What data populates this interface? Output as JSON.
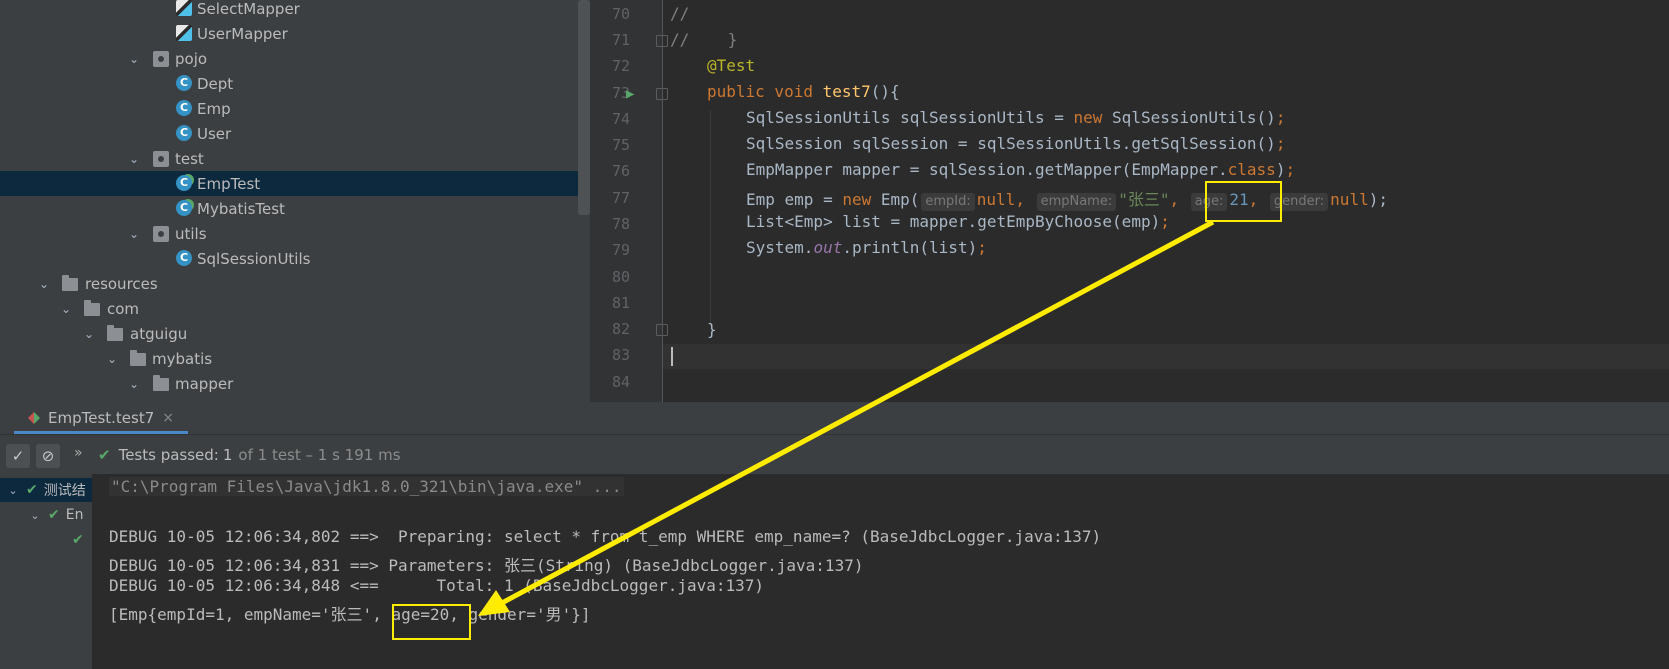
{
  "project_tree": {
    "items": [
      {
        "label": "SelectMapper",
        "icon": "mapper-xml-icon",
        "indent": 5
      },
      {
        "label": "UserMapper",
        "icon": "mapper-xml-icon",
        "indent": 5
      },
      {
        "label": "pojo",
        "icon": "package-icon",
        "indent": 4,
        "expanded": true
      },
      {
        "label": "Dept",
        "icon": "class-icon",
        "indent": 5
      },
      {
        "label": "Emp",
        "icon": "class-icon",
        "indent": 5
      },
      {
        "label": "User",
        "icon": "class-icon",
        "indent": 5
      },
      {
        "label": "test",
        "icon": "package-icon",
        "indent": 4,
        "expanded": true
      },
      {
        "label": "EmpTest",
        "icon": "test-class-icon",
        "indent": 5,
        "selected": true
      },
      {
        "label": "MybatisTest",
        "icon": "test-class-icon",
        "indent": 5
      },
      {
        "label": "utils",
        "icon": "package-icon",
        "indent": 4,
        "expanded": true
      },
      {
        "label": "SqlSessionUtils",
        "icon": "class-icon",
        "indent": 5
      },
      {
        "label": "resources",
        "icon": "resources-folder-icon",
        "indent": 1,
        "expanded": true
      },
      {
        "label": "com",
        "icon": "folder-icon",
        "indent": 2,
        "expanded": true
      },
      {
        "label": "atguigu",
        "icon": "folder-icon",
        "indent": 3,
        "expanded": true
      },
      {
        "label": "mybatis",
        "icon": "folder-icon",
        "indent": 4,
        "expanded": true
      },
      {
        "label": "mapper",
        "icon": "folder-icon",
        "indent": 5,
        "expanded": true
      }
    ]
  },
  "editor": {
    "line_numbers": [
      "70",
      "71",
      "72",
      "73",
      "74",
      "75",
      "76",
      "77",
      "78",
      "79",
      "80",
      "81",
      "82",
      "83",
      "84"
    ],
    "lines": {
      "l70": "//",
      "l71": "//    }",
      "l72_ann": "@Test",
      "l73_kw": "public void ",
      "l73_fn": "test7",
      "l73_rest": "(){",
      "l74_a": "SqlSessionUtils sqlSessionUtils = ",
      "l74_new": "new ",
      "l74_b": "SqlSessionUtils()",
      "l74_semi": ";",
      "l75_a": "SqlSession sqlSession = sqlSessionUtils.getSqlSession()",
      "l75_semi": ";",
      "l76_a": "EmpMapper mapper = sqlSession.getMapper(EmpMapper.",
      "l76_class": "class",
      "l76_b": ")",
      "l76_semi": ";",
      "l77_a": "Emp emp = ",
      "l77_new": "new ",
      "l77_b": "Emp(",
      "l77_hint1": "empId:",
      "l77_null1": "null",
      "l77_comma1": ", ",
      "l77_hint2": "empName:",
      "l77_str": "\"张三\"",
      "l77_comma2": ", ",
      "l77_hint3": "age:",
      "l77_num": "21",
      "l77_hint4": "gender:",
      "l77_null2": "null",
      "l77_end": ");",
      "l78_a": "List<Emp> list = mapper.getEmpByChoose(emp)",
      "l78_semi": ";",
      "l79_a": "System.",
      "l79_out": "out",
      "l79_b": ".println(list)",
      "l79_semi": ";",
      "l82": "}"
    }
  },
  "run_panel": {
    "tab_label": "EmpTest.test7",
    "tab_close": "×",
    "status_label": "Tests passed: ",
    "status_count": "1",
    "status_detail": "of 1 test – 1 s 191 ms",
    "more": "»",
    "tree": {
      "root_label": "测试结",
      "child_label": "En"
    },
    "console": [
      "\"C:\\Program Files\\Java\\jdk1.8.0_321\\bin\\java.exe\" ...",
      "",
      "DEBUG 10-05 12:06:34,802 ==>  Preparing: select * from t_emp WHERE emp_name=? (BaseJdbcLogger.java:137)",
      "DEBUG 10-05 12:06:34,831 ==> Parameters: 张三(String) (BaseJdbcLogger.java:137)",
      "DEBUG 10-05 12:06:34,848 <==      Total: 1 (BaseJdbcLogger.java:137)",
      "[Emp{empId=1, empName='张三', age=20, gender='男'}]"
    ]
  },
  "annotation": {
    "highlight_color": "#ffec00",
    "arrow_from": "age: 21 in editor",
    "arrow_to": "age=20 in console output"
  }
}
